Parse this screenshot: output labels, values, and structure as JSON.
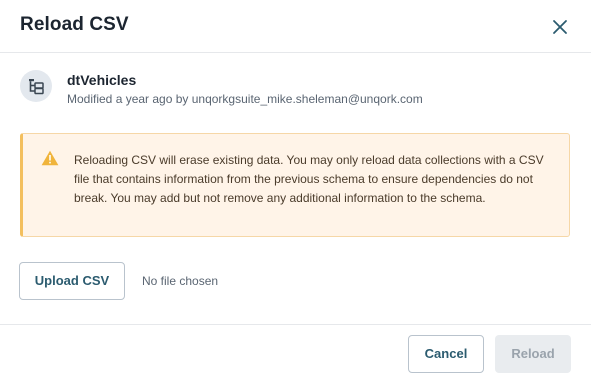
{
  "dialog": {
    "title": "Reload CSV",
    "close_icon": "close-icon"
  },
  "record": {
    "icon": "data-collection-icon",
    "name": "dtVehicles",
    "meta": "Modified a year ago by unqorkgsuite_mike.sheleman@unqork.com"
  },
  "warning": {
    "icon": "warning-triangle-icon",
    "text": "Reloading CSV will erase existing data. You may only reload data collections with a CSV file that contains information from the previous schema to ensure dependencies do not break. You may add but not remove any additional information to the schema."
  },
  "upload": {
    "button_label": "Upload CSV",
    "file_status": "No file chosen"
  },
  "footer": {
    "cancel_label": "Cancel",
    "reload_label": "Reload"
  },
  "colors": {
    "accent": "#2b5b6f",
    "warning_bg": "#fff4e8",
    "warning_border": "#f3bf5e",
    "disabled_bg": "#e9ecef"
  }
}
